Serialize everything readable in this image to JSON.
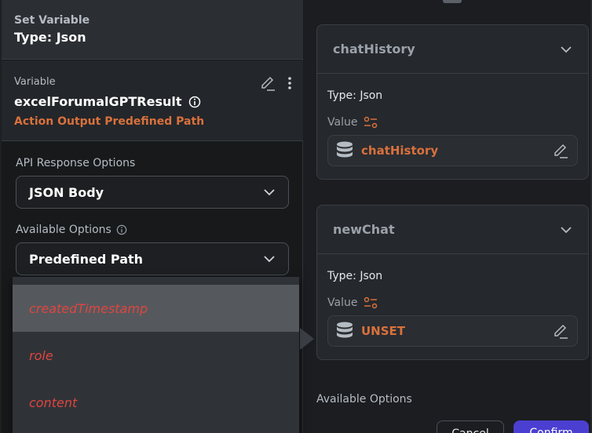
{
  "left_panel": {
    "header_subtitle": "Set Variable",
    "header_title": "Type: Json",
    "variable_label": "Variable",
    "variable_name": "excelForumalGPTResult",
    "variable_source": "Action Output Predefined Path",
    "api_response_label": "API Response Options",
    "api_response_value": "JSON Body",
    "available_options_label": "Available Options",
    "available_options_value": "Predefined Path",
    "dropdown_items": [
      "createdTimestamp",
      "role",
      "content"
    ]
  },
  "right_panel": {
    "cards": [
      {
        "title": "chatHistory",
        "type_line": "Type: Json",
        "value_label": "Value",
        "value": "chatHistory"
      },
      {
        "title": "newChat",
        "type_line": "Type: Json",
        "value_label": "Value",
        "value": "UNSET"
      }
    ],
    "available_options_label": "Available Options",
    "cancel_label": "Cancel",
    "confirm_label": "Confirm"
  },
  "colors": {
    "accent_orange": "#d9713d",
    "dropdown_item_red": "#e0453f",
    "confirm_purple": "#4b3fd1"
  },
  "icons": [
    "edit-pencil-icon",
    "more-vert-icon",
    "info-icon",
    "chevron-down-icon",
    "variable-sliders-icon",
    "database-icon"
  ]
}
